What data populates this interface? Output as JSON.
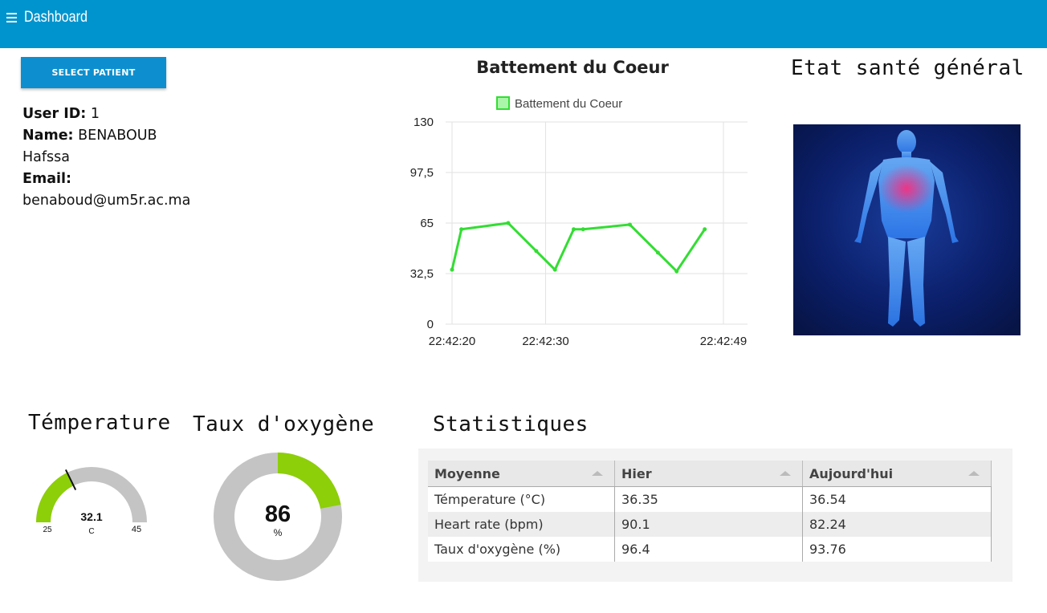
{
  "header": {
    "title": "Dashboard",
    "menu_icon": "hamburger-menu-icon",
    "color": "#0094ce"
  },
  "select_patient": {
    "label": "SELECT PATIENT"
  },
  "patient": {
    "user_id_label": "User ID:",
    "user_id": "1",
    "name_label": "Name:",
    "name_first": "BENABOUB",
    "name_last": "Hafssa",
    "email_label": "Email:",
    "email": "benaboud@um5r.ac.ma"
  },
  "heart": {
    "title": "Battement du Coeur",
    "legend": "Battement du Coeur",
    "color": "#33dd33",
    "chart_data": {
      "type": "line",
      "title": "Battement du Coeur",
      "series": [
        {
          "name": "Battement du Coeur",
          "x": [
            "22:42:20",
            "22:42:21",
            "22:42:26",
            "22:42:29",
            "22:42:31",
            "22:42:33",
            "22:42:34",
            "22:42:39",
            "22:42:42",
            "22:42:44",
            "22:42:47",
            "22:42:49"
          ],
          "values": [
            35,
            61,
            65,
            47,
            35,
            61,
            61,
            64,
            46,
            34,
            61,
            null
          ]
        }
      ],
      "x_ticks": [
        "22:42:20",
        "22:42:30",
        "22:42:49"
      ],
      "y_ticks": [
        "0",
        "32,5",
        "65",
        "97,5",
        "130"
      ],
      "ylim": [
        0,
        130
      ],
      "grid": true,
      "legend_position": "top"
    }
  },
  "general": {
    "title": "Etat santé général",
    "image_icon": "human-body-anatomy-image"
  },
  "temperature": {
    "title": "Témperature",
    "value": "32.1",
    "unit": "C",
    "min": "25",
    "max": "45",
    "value_num": 32.1,
    "min_num": 25,
    "max_num": 45,
    "fill_color": "#8dcf08",
    "track_color": "#c4c4c4"
  },
  "oxygen": {
    "title": "Taux d'oxygène",
    "value": "86",
    "unit": "%",
    "fill_fraction": 0.22,
    "fill_color": "#8dcf08",
    "track_color": "#c4c4c4"
  },
  "stats": {
    "title": "Statistiques",
    "headers": [
      "Moyenne",
      "Hier",
      "Aujourd'hui"
    ],
    "rows": [
      [
        "Témperature (°C)",
        "36.35",
        "36.54"
      ],
      [
        "Heart rate (bpm)",
        "90.1",
        "82.24"
      ],
      [
        "Taux d'oxygène (%)",
        "96.4",
        "93.76"
      ]
    ]
  }
}
